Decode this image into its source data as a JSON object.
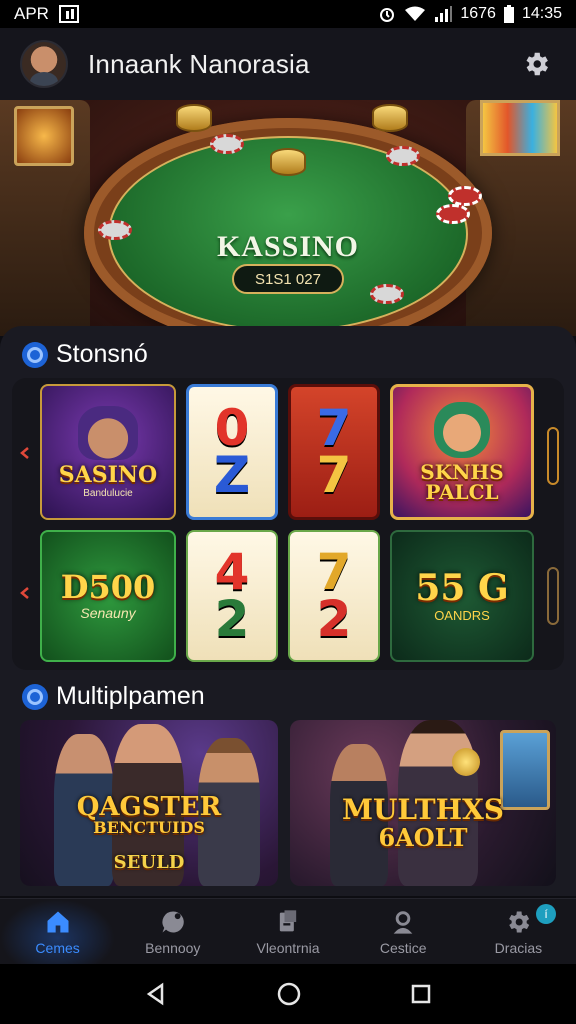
{
  "status_bar": {
    "carrier": "APR",
    "right_text": "1676",
    "time": "14:35"
  },
  "header": {
    "title": "Innaank Nanorasia"
  },
  "hero": {
    "felt_title": "KASSINO",
    "badge": "S1S1 027"
  },
  "section_slots": {
    "title": "Stonsnó",
    "tiles": [
      {
        "label": "SASINO",
        "sub": "Bandulucie"
      },
      {
        "top": "0",
        "bottom": "Z"
      },
      {
        "top": "7",
        "bottom": "7"
      },
      {
        "label": "SKNHS PALCL"
      },
      {
        "label": "D500",
        "sub": "Senauny"
      },
      {
        "top": "4",
        "bottom": "2"
      },
      {
        "top": "7",
        "bottom": "2"
      },
      {
        "label": "55 G",
        "sub": "OANDRS"
      }
    ]
  },
  "section_multiplayer": {
    "title": "Multiplpamen",
    "cards": [
      {
        "title": "QAGSTER",
        "sub": "BENCTUIDS",
        "foot": "SEULD"
      },
      {
        "title": "MULTHXS",
        "sub": "6AOLT"
      }
    ]
  },
  "bottom_nav": {
    "items": [
      {
        "label": "Cemes",
        "icon": "home-icon"
      },
      {
        "label": "Bennooy",
        "icon": "chat-icon"
      },
      {
        "label": "Vleontrnia",
        "icon": "trophy-icon"
      },
      {
        "label": "Cestice",
        "icon": "profile-icon"
      },
      {
        "label": "Dracias",
        "icon": "gear-icon"
      }
    ],
    "badge": "í"
  },
  "colors": {
    "accent": "#3b8cff",
    "felt": "#2f8a3e",
    "gold": "#ffd54a",
    "panel": "#1a1a22"
  }
}
